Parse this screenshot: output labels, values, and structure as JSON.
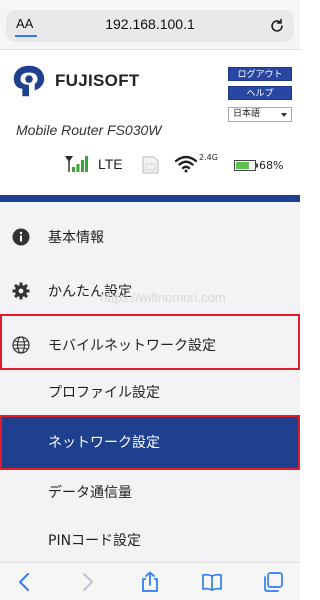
{
  "browser": {
    "aa_label": "AA",
    "url": "192.168.100.1"
  },
  "header": {
    "logo_text": "FUJISOFT",
    "logout_label": "ログアウト",
    "help_label": "ヘルプ",
    "language": "日本語",
    "model": "Mobile Router FS030W",
    "network_type": "LTE",
    "wifi_band": "2.4G",
    "battery_percent": "68%",
    "battery_level": 0.68,
    "signal_bars": 4
  },
  "menu": {
    "items": [
      {
        "label": "基本情報",
        "icon": "info-icon"
      },
      {
        "label": "かんたん設定",
        "icon": "gear-icon"
      },
      {
        "label": "モバイルネットワーク設定",
        "icon": "globe-icon"
      }
    ],
    "subitems": [
      {
        "label": "プロファイル設定"
      },
      {
        "label": "ネットワーク設定"
      },
      {
        "label": "データ通信量"
      },
      {
        "label": "PINコード設定"
      }
    ]
  },
  "watermark": "https://wifinomori.com",
  "colors": {
    "brand_blue": "#1f3f8f",
    "button_blue": "#2946a2",
    "highlight_red": "#e01d2b",
    "ios_blue": "#2f7cf6"
  }
}
